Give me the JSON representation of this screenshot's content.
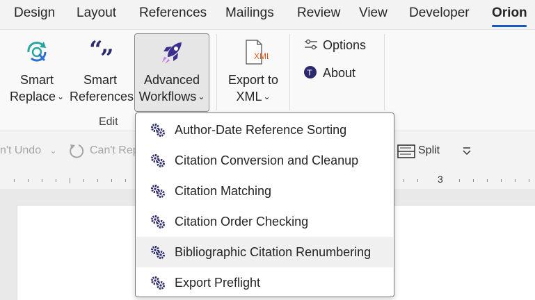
{
  "tabs": [
    {
      "label": "Design"
    },
    {
      "label": "Layout"
    },
    {
      "label": "References"
    },
    {
      "label": "Mailings"
    },
    {
      "label": "Review"
    },
    {
      "label": "View"
    },
    {
      "label": "Developer"
    },
    {
      "label": "Orion",
      "active": true
    }
  ],
  "ribbon": {
    "smart_replace": {
      "line1": "Smart",
      "line2": "Replace",
      "icon": "smart-replace-icon"
    },
    "smart_references": {
      "line1": "Smart",
      "line2": "References",
      "icon": "quote-icon"
    },
    "advanced_workflows": {
      "line1": "Advanced",
      "line2": "Workflows",
      "icon": "rocket-icon"
    },
    "export_xml": {
      "line1": "Export to",
      "line2": "XML",
      "icon": "xml-file-icon",
      "badge": "XML"
    },
    "options_label": "Options",
    "about_label": "About",
    "edit_group_label": "Edit"
  },
  "toolbar": {
    "undo_label": "n't Undo",
    "repeat_label": "Can't Rep",
    "split_label": "Split"
  },
  "ruler": {
    "number": "3"
  },
  "menu": {
    "items": [
      {
        "label": "Author-Date Reference Sorting",
        "icon": "gears-icon"
      },
      {
        "label": "Citation Conversion and Cleanup",
        "icon": "gears-icon"
      },
      {
        "label": "Citation Matching",
        "icon": "gears-icon"
      },
      {
        "label": "Citation Order Checking",
        "icon": "gears-icon"
      },
      {
        "label": "Bibliographic Citation Renumbering",
        "icon": "gears-icon",
        "highlighted": true
      },
      {
        "label": "Export Preflight",
        "icon": "gears-icon"
      }
    ]
  },
  "colors": {
    "accent": "#185abd",
    "gear_icon": "#2b2a6e",
    "rocket_primary": "#3b2f8f",
    "rocket_flame": "#c678e8",
    "xml_badge": "#e0581c",
    "smart_replace_teal": "#2aa6a0",
    "smart_replace_blue": "#2f6fd6"
  }
}
